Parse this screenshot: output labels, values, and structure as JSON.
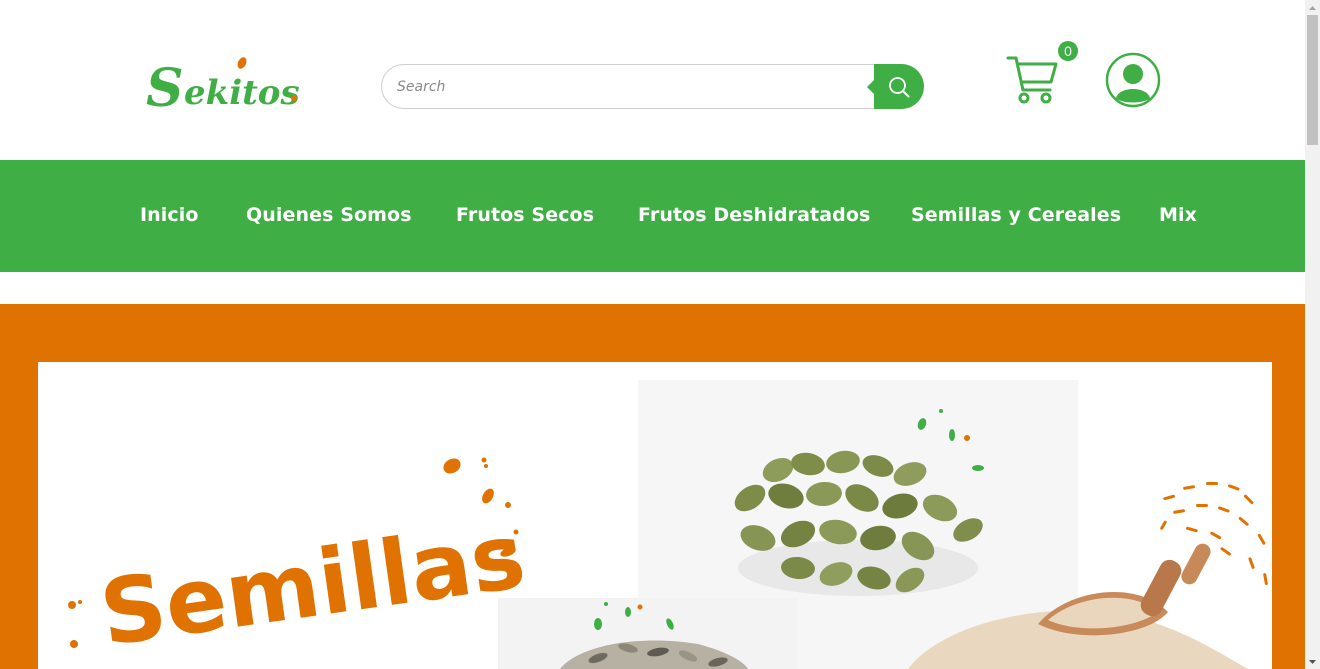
{
  "brand": {
    "logo_text": "Sekitos",
    "primary_color": "#3fae45",
    "accent_color": "#df7200"
  },
  "header": {
    "search": {
      "placeholder": "Search",
      "value": ""
    },
    "search_button_icon": "search-icon",
    "cart": {
      "icon": "cart-icon",
      "count": "0"
    },
    "account_icon": "user-icon"
  },
  "nav": {
    "items": [
      {
        "label": "Inicio"
      },
      {
        "label": "Quienes Somos"
      },
      {
        "label": "Frutos Secos"
      },
      {
        "label": "Frutos Deshidratados"
      },
      {
        "label": "Semillas y Cereales"
      },
      {
        "label": "Mix"
      }
    ]
  },
  "hero": {
    "title": "Semillas",
    "images": [
      "pumpkin-seeds",
      "sunflower-seeds",
      "quinoa-with-wooden-scoop"
    ]
  }
}
